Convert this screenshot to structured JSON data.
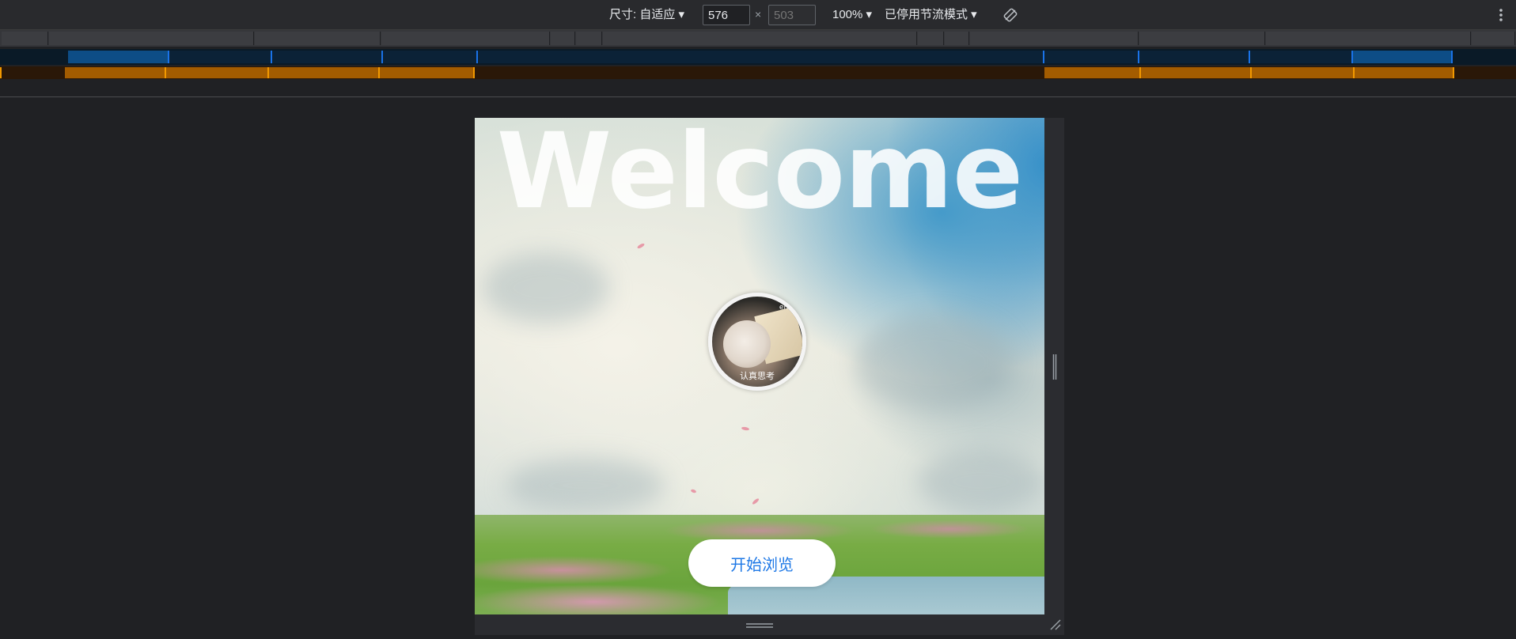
{
  "toolbar": {
    "dimensions_label": "尺寸: 自适应 ▾",
    "width_value": "576",
    "times": "×",
    "height_placeholder": "503",
    "zoom_label": "100% ▾",
    "throttle_label": "已停用节流模式 ▾",
    "rotate_icon": "rotate-icon",
    "more_icon": "more-vertical-icon"
  },
  "page": {
    "title": "Welcome",
    "avatar": {
      "caption_top": "emm",
      "caption_bottom": "认真思考"
    },
    "start_button": "开始浏览"
  },
  "colors": {
    "accent": "#1e78e6",
    "toolbar_bg": "#292a2d",
    "media_blue": "#1a73e8",
    "media_orange": "#f29900"
  }
}
